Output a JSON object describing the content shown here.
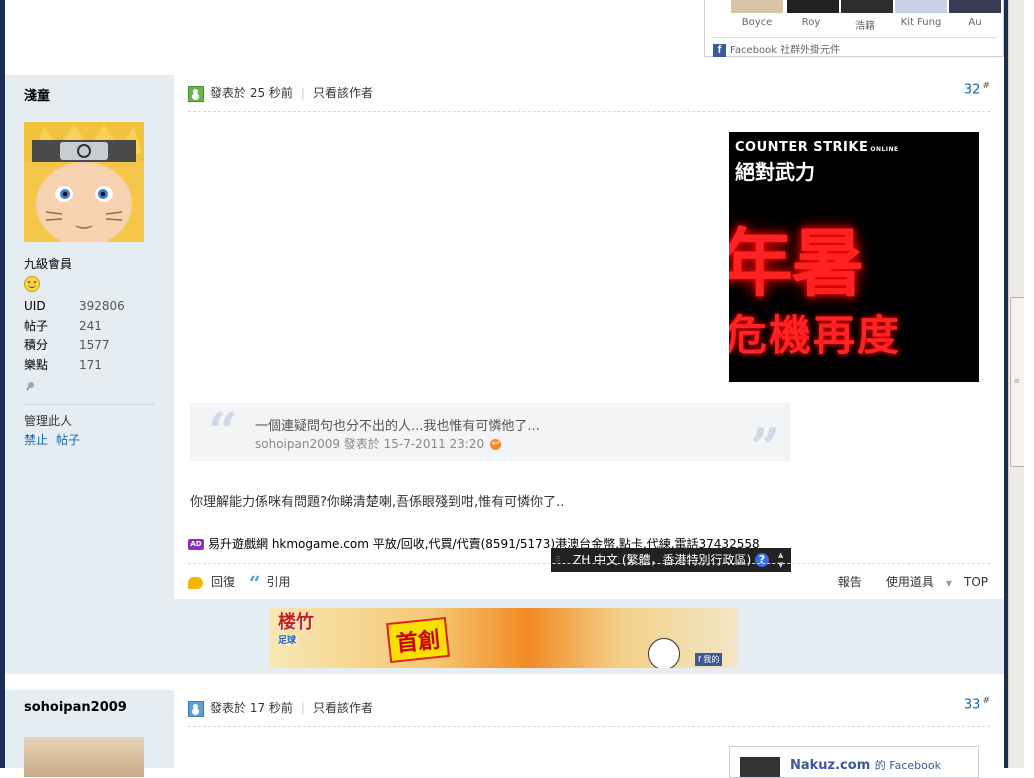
{
  "facebook_widget": {
    "names": [
      "Boyce",
      "Roy",
      "浩籍",
      "Kit Fung",
      "Au"
    ],
    "footer": "Facebook 社群外掛元件"
  },
  "post1": {
    "author": "淺童",
    "level": "九級會員",
    "stats": [
      {
        "label": "UID",
        "value": "392806"
      },
      {
        "label": "帖子",
        "value": "241"
      },
      {
        "label": "積分",
        "value": "1577"
      },
      {
        "label": "樂點",
        "value": "171"
      }
    ],
    "manage_label": "管理此人",
    "manage_links": [
      "禁止",
      "帖子"
    ],
    "posted": "發表於 25 秒前",
    "only_author": "只看該作者",
    "floor": "32",
    "floor_mark": "#",
    "ad_image": {
      "brand": "COUNTER STRIKE",
      "brand_sub": "ONLINE",
      "title": "絕對武力",
      "big_text": "年暑",
      "mid_text": "危機再度"
    },
    "quote": {
      "text": "一個連疑問句也分不出的人...我也惟有可憐他了...",
      "source": "sohoipan2009 發表於 15-7-2011 23:20"
    },
    "body": "你理解能力係咪有問題?你睇清楚喇,吾係眼殘到咁,惟有可憐你了..",
    "ad_badge": "AD",
    "ad_text": "易升遊戲網 hkmogame.com 平放/回收,代買/代賣(8591/5173)港澳台金幣,點卡,代練,電話37432558",
    "actions": {
      "reply": "回復",
      "quote": "引用",
      "report": "報告",
      "tools": "使用道具",
      "top": "TOP"
    }
  },
  "language_bar": {
    "label": "ZH 中文 (繁體，香港特別行政區)",
    "help": "?"
  },
  "banner": {
    "logo": "楼竹",
    "logo_sub": "足球",
    "badge": "首創",
    "like": "f 我的"
  },
  "post2": {
    "author": "sohoipan2009",
    "posted": "發表於 17 秒前",
    "only_author": "只看該作者",
    "floor": "33",
    "floor_mark": "#",
    "fb_title": "Nakuz.com",
    "fb_suffix": "的 Facebook"
  }
}
